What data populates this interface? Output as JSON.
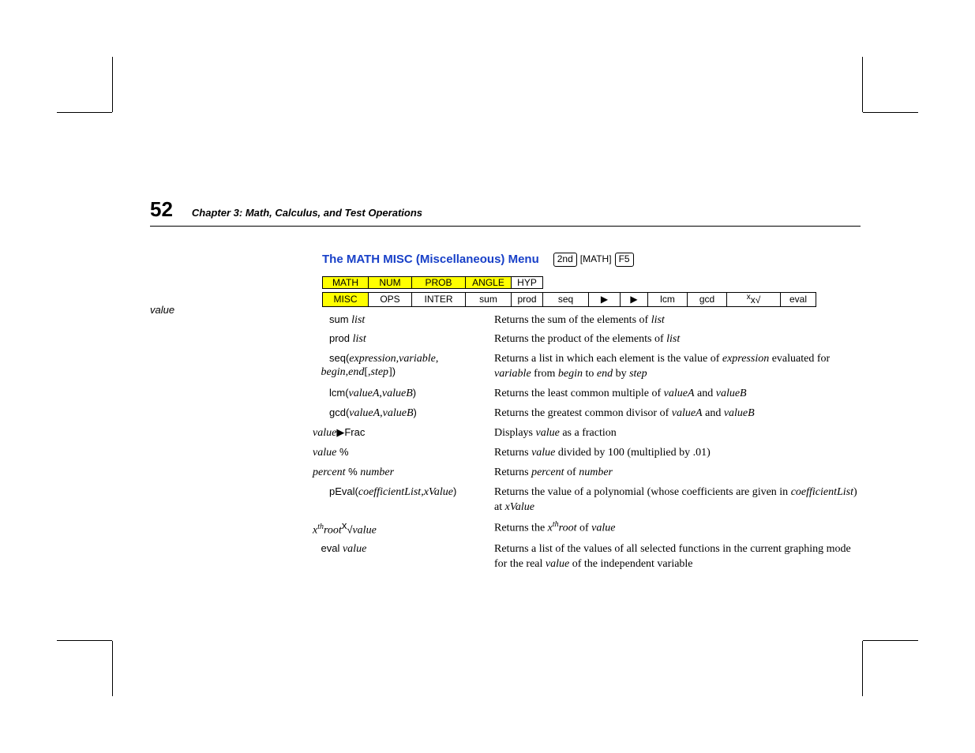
{
  "page_number": "52",
  "chapter": "Chapter 3:  Math, Calculus, and Test Operations",
  "section_title": "The MATH MISC (Miscellaneous) Menu",
  "keys": {
    "k2nd": "2nd",
    "math": "[MATH]",
    "f5": "F5"
  },
  "margin_note": "value",
  "menu_row1": {
    "c1": "MATH",
    "c2": "NUM",
    "c3": "PROB",
    "c4": "ANGLE",
    "c5": "HYP"
  },
  "menu_row2": {
    "c1": "MISC",
    "c2": "OPS",
    "c3": "INTER",
    "c4": "sum",
    "c5": "prod",
    "c6": "seq",
    "c7": "▶",
    "c8": "▶",
    "c9": "lcm",
    "c10": "gcd",
    "c11": "x√",
    "c12": "eval"
  },
  "defs": [
    {
      "term_pre": "sum ",
      "term_it": "list",
      "desc_pre": "Returns the sum of the elements of ",
      "desc_it": "list"
    },
    {
      "term_pre": "prod ",
      "term_it": "list",
      "desc_pre": "Returns the product of the elements of ",
      "desc_it": "list"
    },
    {
      "term_pre": "seq(",
      "term_it": "expression",
      "term_sep": ",",
      "term_it2": "variable",
      "term_sep2": ",",
      "term_line2_it": "begin",
      "term_line2_sep": ",",
      "term_line2_it2": "end",
      "term_line2_sep2": "[,",
      "term_line2_it3": "step",
      "term_line2_close": "]",
      "term_close": ")",
      "desc": "Returns a list in which each element is the value of ",
      "desc_it": "expression",
      "desc2": " evaluated for ",
      "desc_it2": "variable",
      "desc3": " from ",
      "desc_it3": "begin",
      "desc4": " to ",
      "desc_it4": "end",
      "desc5": " by ",
      "desc_it5": "step"
    },
    {
      "term_pre": "lcm(",
      "term_it": "valueA",
      "term_sep": ",",
      "term_it2": "valueB",
      "term_close": ")",
      "desc_pre": "Returns the least common multiple of ",
      "desc_it": "valueA",
      "desc_mid": " and ",
      "desc_it2": "valueB"
    },
    {
      "term_pre": "gcd(",
      "term_it": "valueA,valueB",
      "term_close": ")",
      "desc_pre": "Returns the greatest common divisor of ",
      "desc_it": "valueA",
      "desc_mid": " and ",
      "desc_it2": "valueB"
    },
    {
      "term_it": "value",
      "term_post": "▶Frac",
      "desc_pre": "Displays ",
      "desc_it": "value",
      "desc_post": " as a fraction"
    },
    {
      "term_it": "value",
      "term_post": " %",
      "desc_pre": "Returns ",
      "desc_it": "value",
      "desc_post": " divided by 100 (multiplied by .01)"
    },
    {
      "term_it": "percent",
      "term_mid": " % ",
      "term_it2": "number",
      "desc_pre": "Returns ",
      "desc_it": "percent",
      "desc_mid": " of ",
      "desc_it2": "number"
    },
    {
      "term_pre": "pEval(",
      "term_it": "coefficientList",
      "term_sep": ",",
      "term_it2": "xValue",
      "term_close": ")",
      "desc": "Returns the value of a polynomial (whose coefficients are given in ",
      "desc_it": "coefficientList",
      "desc2": ") at ",
      "desc_it2": "xValue"
    },
    {
      "term_raw": "x",
      "term_sup": "th",
      "term_raw2": "root",
      "term_sup2": "x",
      "term_raw3": "√",
      "term_it": "value",
      "desc_pre": "Returns the ",
      "desc_itraw": "x",
      "desc_sup": "th",
      "desc_it": "root",
      "desc_mid": " of ",
      "desc_it2": "value"
    },
    {
      "term_pre": "eval ",
      "term_it": "value",
      "desc": "Returns a list of the values of all selected functions in the current graphing mode for the real ",
      "desc_it": "value",
      "desc2": " of the independent variable"
    }
  ]
}
